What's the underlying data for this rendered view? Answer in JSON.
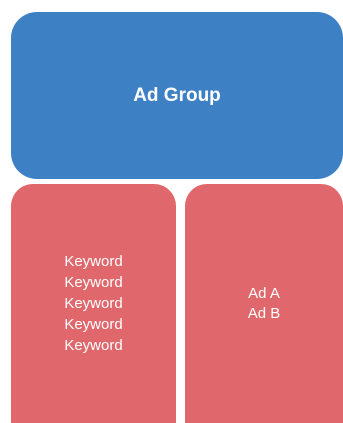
{
  "diagram": {
    "ad_group": {
      "label": "Ad Group",
      "color": "#3d80c4"
    },
    "keywords_box": {
      "items": [
        "Keyword",
        "Keyword",
        "Keyword",
        "Keyword",
        "Keyword"
      ],
      "color": "#e0676b"
    },
    "ads_box": {
      "items": [
        "Ad A",
        "Ad B"
      ],
      "color": "#e0676b"
    }
  }
}
